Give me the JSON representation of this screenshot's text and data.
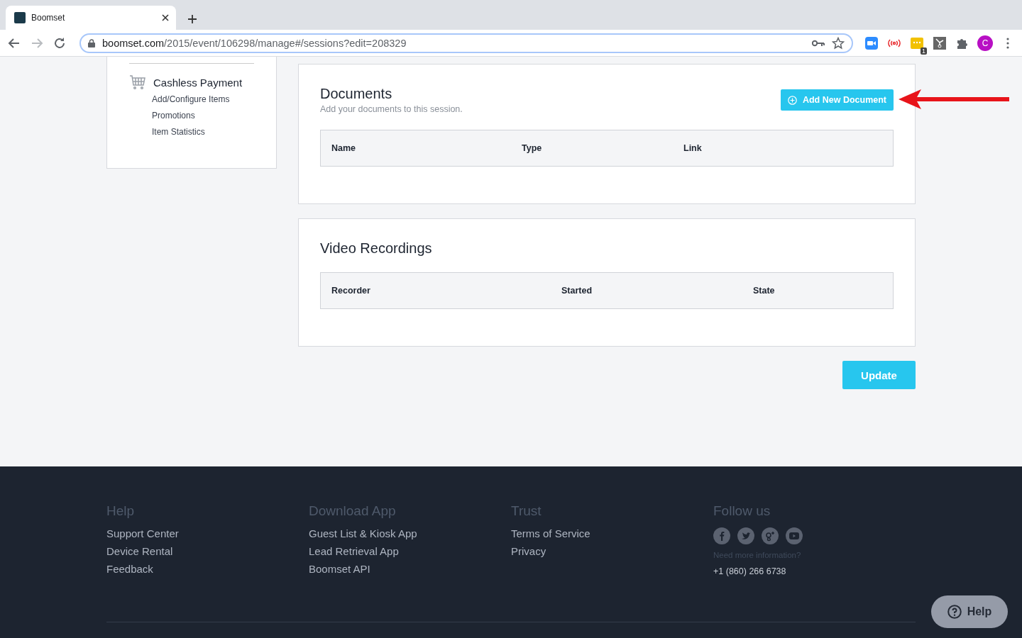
{
  "browser": {
    "tab_title": "Boomset",
    "url_host": "boomset.com",
    "url_path": "/2015/event/106298/manage#/sessions?edit=208329",
    "extension_badge": "1",
    "profile_initial": "C"
  },
  "sidebar": {
    "title": "Cashless Payment",
    "items": [
      "Add/Configure Items",
      "Promotions",
      "Item Statistics"
    ]
  },
  "cards": [
    {
      "title": "Documents",
      "subtitle": "Add your documents to this session.",
      "button": "Add New Document",
      "columns": [
        "Name",
        "Type",
        "Link"
      ]
    },
    {
      "title": "Video Recordings",
      "columns": [
        "Recorder",
        "Started",
        "State"
      ]
    }
  ],
  "update_button": "Update",
  "footer": {
    "columns": [
      {
        "heading": "Help",
        "links": [
          "Support Center",
          "Device Rental",
          "Feedback"
        ]
      },
      {
        "heading": "Download App",
        "links": [
          "Guest List & Kiosk App",
          "Lead Retrieval App",
          "Boomset API"
        ]
      },
      {
        "heading": "Trust",
        "links": [
          "Terms of Service",
          "Privacy"
        ]
      }
    ],
    "follow": {
      "heading": "Follow us",
      "note": "Need more information?",
      "phone": "+1 (860) 266 6738"
    }
  },
  "help_button": "Help"
}
